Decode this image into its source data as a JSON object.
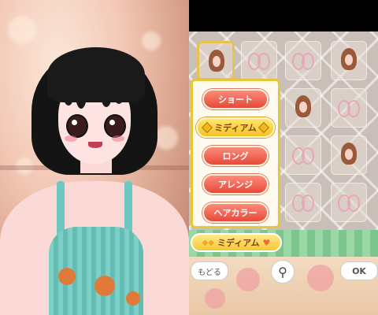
{
  "menu": {
    "items": [
      {
        "label": "ショート",
        "active": false
      },
      {
        "label": "ミディアム",
        "active": true
      },
      {
        "label": "ロング",
        "active": false
      },
      {
        "label": "アレンジ",
        "active": false
      },
      {
        "label": "ヘアカラー",
        "active": false
      }
    ]
  },
  "selection": {
    "category_label": "ミディアム"
  },
  "bottom_bar": {
    "back_label": "もどる",
    "ok_label": "OK"
  },
  "icons": {
    "figure": "person-figure-icon",
    "heart": "heart-icon",
    "jewel": "jewel-icon",
    "bow": "ribbon-bow-icon"
  },
  "colors": {
    "menu_button": "#e54a3a",
    "active_button": "#f2c225",
    "menu_border": "#e9c53a",
    "stripe_bar": "#7cc68e"
  }
}
